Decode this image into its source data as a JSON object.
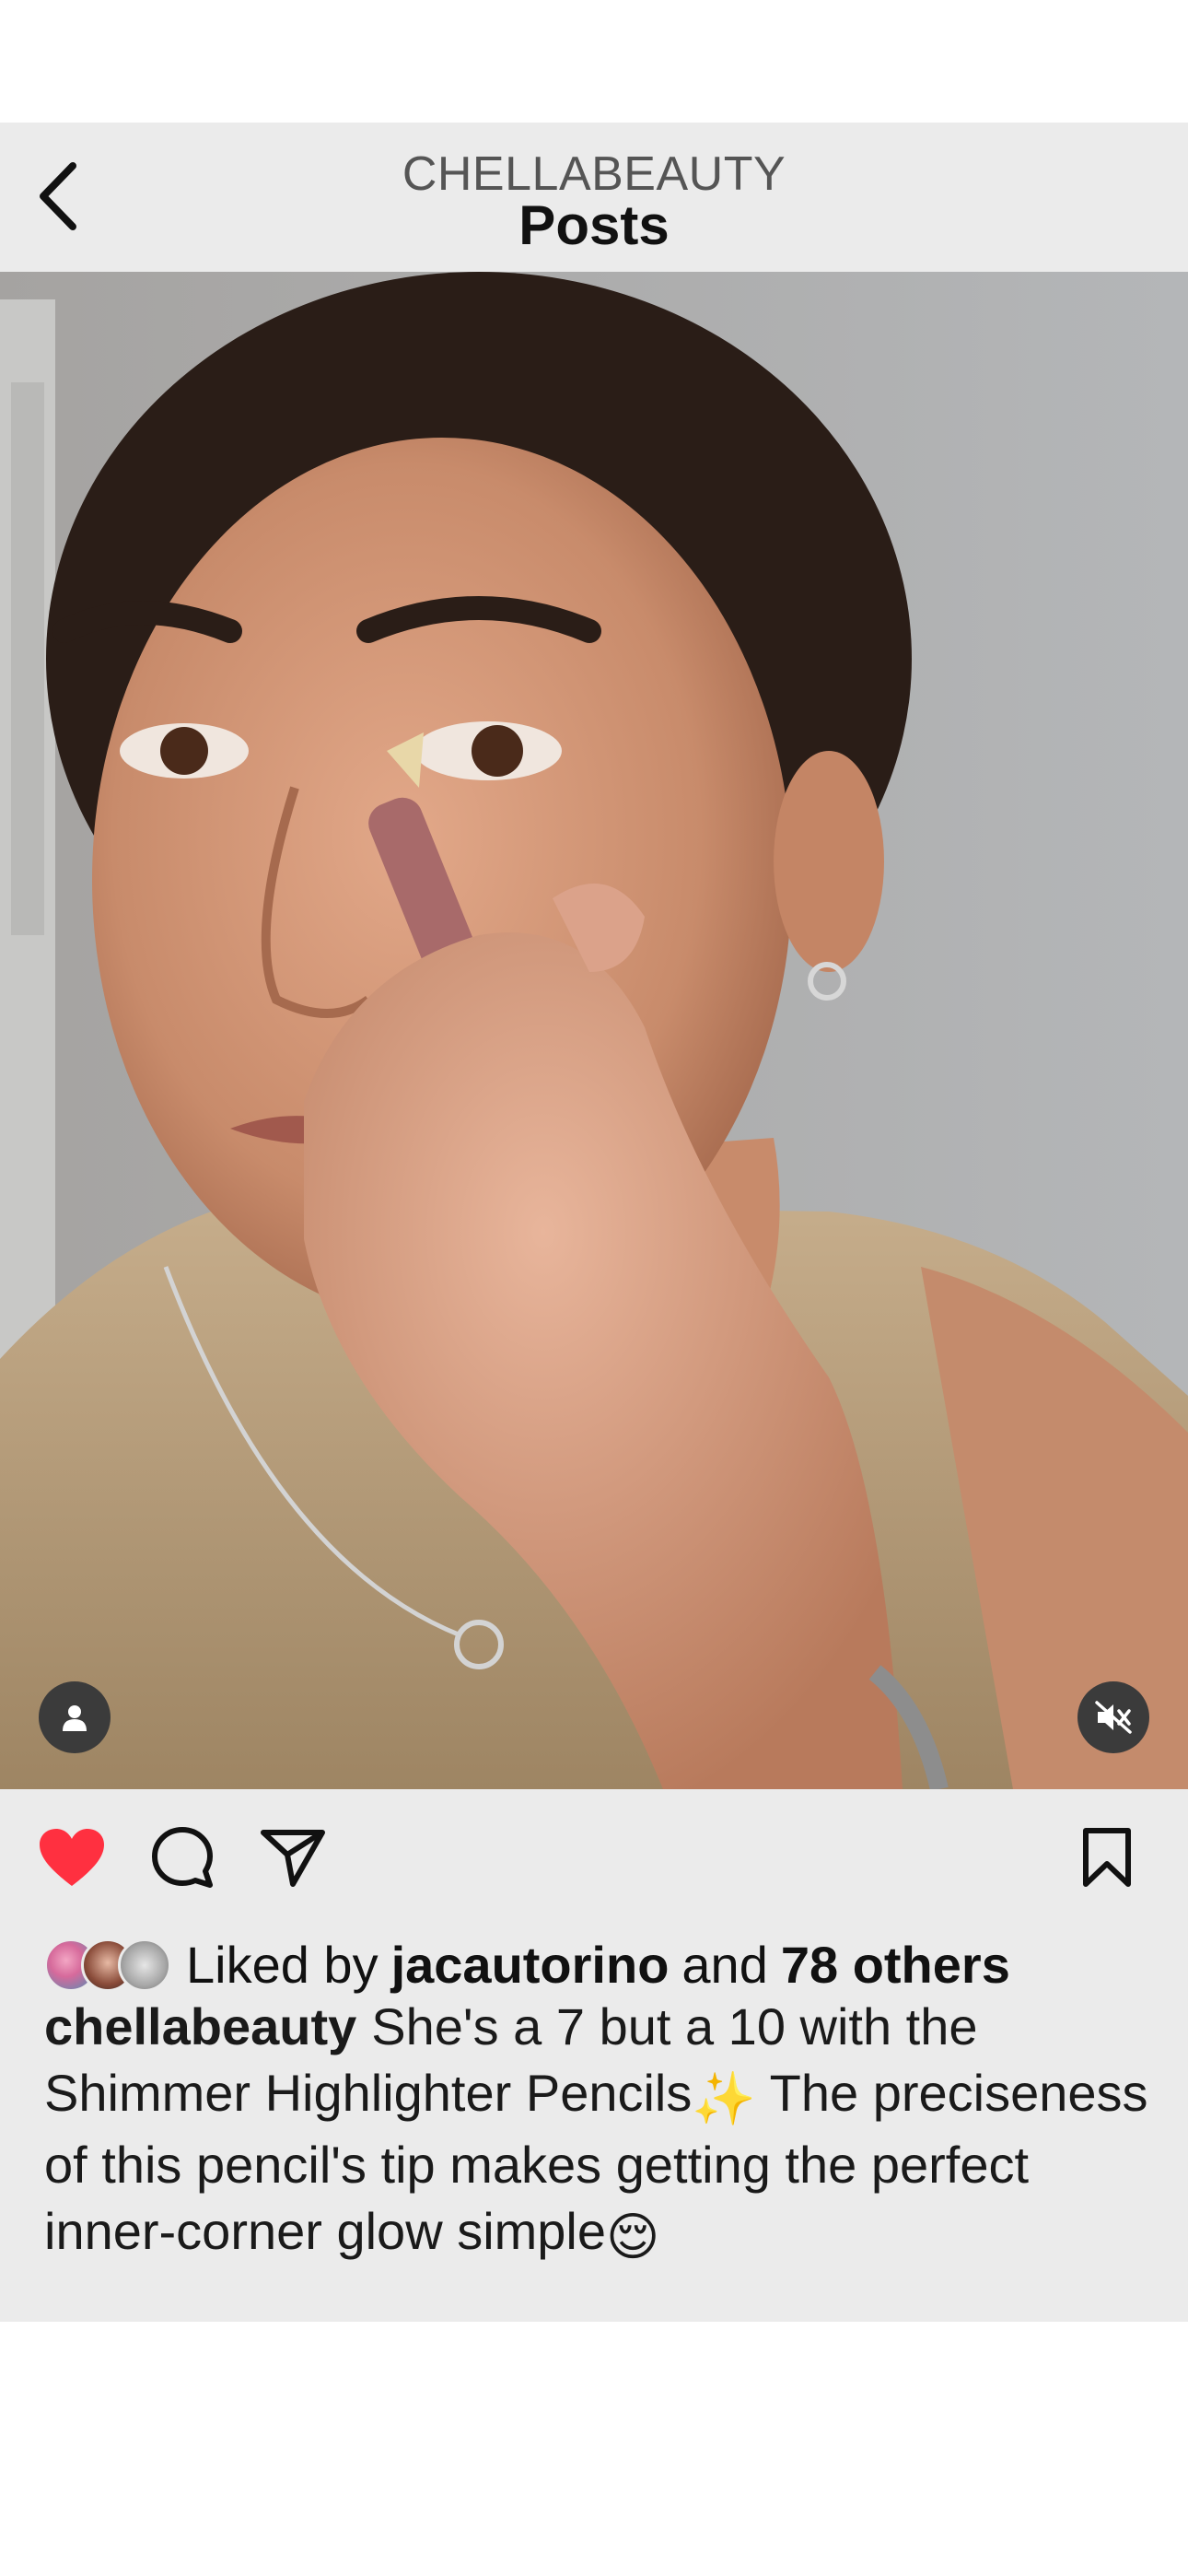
{
  "header": {
    "account": "CHELLABEAUTY",
    "title": "Posts",
    "back_icon": "chevron-left-icon"
  },
  "media": {
    "type": "video",
    "tag_icon": "person-icon",
    "mute_icon": "speaker-muted-icon"
  },
  "actions": {
    "like_icon": "heart-filled-icon",
    "comment_icon": "comment-icon",
    "share_icon": "send-icon",
    "save_icon": "bookmark-icon",
    "liked": true,
    "like_color": "#ff3040"
  },
  "likes": {
    "prefix": "Liked by",
    "user": "jacautorino",
    "connector": "and",
    "others": "78 others"
  },
  "caption": {
    "user": "chellabeauty",
    "text_part1": "She's a 7 but a 10 with the Shimmer Highlighter Pencils",
    "sparkle": "✨",
    "text_part2": "The preciseness of this pencil's tip makes getting the perfect inner-corner glow simple",
    "relieved": "😌"
  },
  "colors": {
    "panel_bg": "#ebebeb",
    "text": "#111111"
  }
}
